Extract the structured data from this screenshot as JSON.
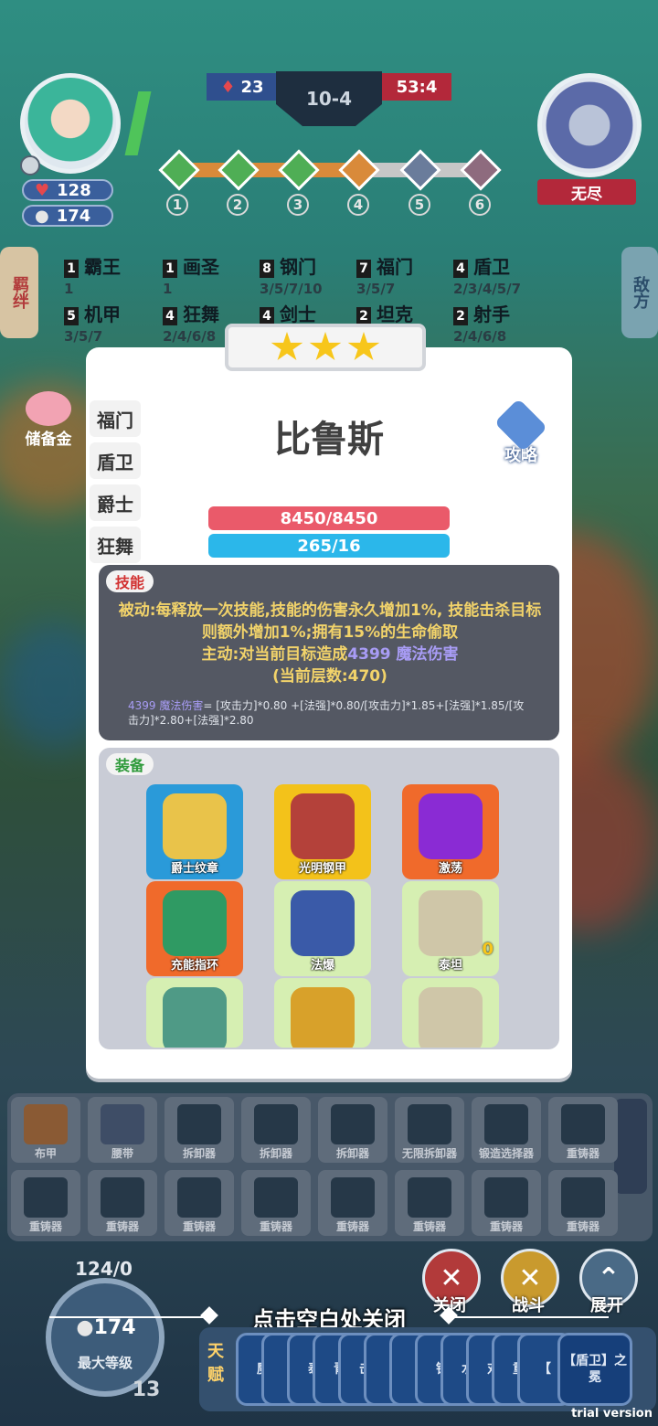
{
  "hud": {
    "hp": "128",
    "gold": "174",
    "score_left": "23",
    "round": "10-4",
    "score_right": "53:4",
    "stages": [
      "1",
      "2",
      "3",
      "4",
      "5",
      "6"
    ],
    "enemy_label": "无尽",
    "left_tab": "羁绊",
    "right_tab": "敌方",
    "reserve_label": "储备金"
  },
  "synergies": [
    {
      "count": "1",
      "name": "霸王",
      "steps": "1"
    },
    {
      "count": "1",
      "name": "画圣",
      "steps": "1"
    },
    {
      "count": "8",
      "name": "钢门",
      "steps": "3/5/7/10"
    },
    {
      "count": "7",
      "name": "福门",
      "steps": "3/5/7"
    },
    {
      "count": "4",
      "name": "盾卫",
      "steps": "2/3/4/5/7"
    },
    {
      "count": "5",
      "name": "机甲",
      "steps": "3/5/7"
    },
    {
      "count": "4",
      "name": "狂舞",
      "steps": "2/4/6/8"
    },
    {
      "count": "4",
      "name": "剑士",
      "steps": ""
    },
    {
      "count": "2",
      "name": "坦克",
      "steps": ""
    },
    {
      "count": "2",
      "name": "射手",
      "steps": "2/4/6/8"
    }
  ],
  "panel": {
    "stars": 3,
    "traits": [
      "福门",
      "盾卫",
      "爵士",
      "狂舞"
    ],
    "hero_name": "比鲁斯",
    "guide_label": "攻略",
    "hp_text": "8450/8450",
    "mana_text": "265/16",
    "skill_tag": "技能",
    "skill_passive": "被动:每释放一次技能,技能的伤害永久增加1%, 技能击杀目标则额外增加1%;拥有15%的生命偷取",
    "skill_active_prefix": "主动:对当前目标造成",
    "skill_active_damage": "4399 魔法伤害",
    "skill_layers": "(当前层数:470)",
    "formula_value": "4399 魔法伤害",
    "formula_text": "= [攻击力]*0.80 +[法强]*0.80/[攻击力]*1.85+[法强]*1.85/[攻击力]*2.80+[法强]*2.80",
    "equip_tag": "装备",
    "items": [
      {
        "label": "爵士纹章",
        "bg": "#2a9ad9",
        "icon": "#e9c34a"
      },
      {
        "label": "光明钢甲",
        "bg": "#f3c21a",
        "icon": "#b4413a"
      },
      {
        "label": "激荡",
        "bg": "#f06a2b",
        "icon": "#8a2bd4"
      },
      {
        "label": "充能指环",
        "bg": "#f06a2b",
        "icon": "#2f9a63"
      },
      {
        "label": "法爆",
        "bg": "#d6efb2",
        "icon": "#3a5aa8"
      },
      {
        "label": "泰坦",
        "bg": "#d6efb2",
        "icon": "#cfc6a8",
        "badge": "0"
      },
      {
        "label": "",
        "bg": "#d6efb2",
        "icon": "#4f9a86"
      },
      {
        "label": "",
        "bg": "#d6efb2",
        "icon": "#d8a12a"
      },
      {
        "label": "",
        "bg": "#d6efb2",
        "icon": "#cfc6a8"
      }
    ]
  },
  "bench": {
    "row1": [
      "布甲",
      "腰带",
      "拆卸器",
      "拆卸器",
      "拆卸器",
      "无限拆卸器",
      "锻造选择器",
      "重铸器"
    ],
    "row2": [
      "重铸器",
      "重铸器",
      "重铸器",
      "重铸器",
      "重铸器",
      "重铸器",
      "重铸器",
      "重铸器"
    ]
  },
  "bottom": {
    "xp": "124/0",
    "level_gold": "174",
    "level_label": "最大等级",
    "level_number": "13",
    "close_hint": "点击空白处关闭",
    "btn_close": "关闭",
    "btn_fight": "战斗",
    "btn_expand": "展开",
    "talent_label": "天赋",
    "talents": [
      "魔",
      "",
      "泰",
      "青",
      "击",
      "【",
      "【",
      "钢",
      "水",
      "对",
      "重",
      "【",
      "【盾卫】之冕"
    ],
    "trial": "trial version"
  }
}
